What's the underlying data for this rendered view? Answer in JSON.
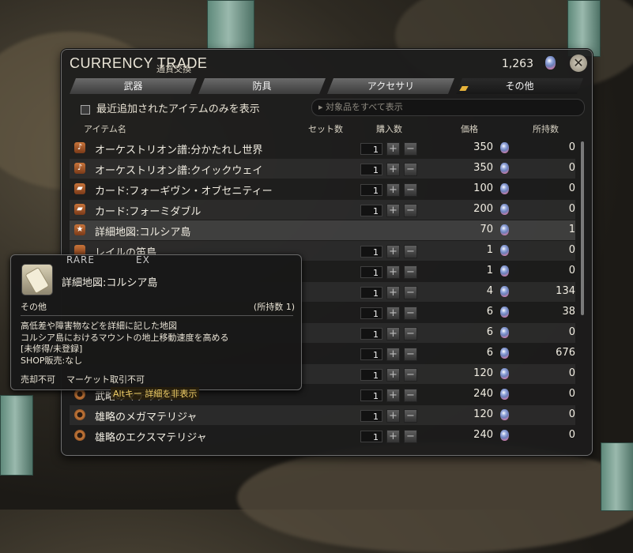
{
  "window": {
    "title": "CURRENCY TRADE",
    "subtitle": "通貨交換",
    "currency_amount": "1,263",
    "close_icon": "close-icon"
  },
  "tabs": [
    {
      "label": "武器",
      "active": false
    },
    {
      "label": "防具",
      "active": false
    },
    {
      "label": "アクセサリ",
      "active": false
    },
    {
      "label": "その他",
      "active": true
    }
  ],
  "filter": {
    "checkbox_label": "最近追加されたアイテムのみを表示",
    "search_placeholder": "▸ 対象品をすべて表示"
  },
  "columns": {
    "name": "アイテム名",
    "set": "セット数",
    "buy": "購入数",
    "price": "価格",
    "owned": "所持数"
  },
  "rows": [
    {
      "icon": "music-icon",
      "name": "オーケストリオン譜:分かたれし世界",
      "qty": "1",
      "price": "350",
      "owned": "0"
    },
    {
      "icon": "music-icon",
      "name": "オーケストリオン譜:クイックウェイ",
      "qty": "1",
      "price": "350",
      "owned": "0"
    },
    {
      "icon": "card-icon",
      "name": "カード:フォーギヴン・オブセニティー",
      "qty": "1",
      "price": "100",
      "owned": "0"
    },
    {
      "icon": "card-icon",
      "name": "カード:フォーミダブル",
      "qty": "1",
      "price": "200",
      "owned": "0"
    },
    {
      "icon": "star-icon",
      "name": "詳細地図:コルシア島",
      "qty": "",
      "price": "70",
      "owned": "1"
    },
    {
      "icon": "item-icon",
      "name": "レイルの笛鳥",
      "qty": "1",
      "price": "1",
      "owned": "0"
    },
    {
      "icon": "item-icon",
      "name": "",
      "qty": "1",
      "price": "1",
      "owned": "0"
    },
    {
      "icon": "item-icon",
      "name": "",
      "qty": "1",
      "price": "4",
      "owned": "134"
    },
    {
      "icon": "item-icon",
      "name": "",
      "qty": "1",
      "price": "6",
      "owned": "38"
    },
    {
      "icon": "item-icon",
      "name": "",
      "qty": "1",
      "price": "6",
      "owned": "0"
    },
    {
      "icon": "item-icon",
      "name": "",
      "qty": "1",
      "price": "6",
      "owned": "676"
    },
    {
      "icon": "item-icon",
      "name": "",
      "qty": "1",
      "price": "120",
      "owned": "0"
    },
    {
      "icon": "materia-icon",
      "name": "武略のマテリジャ",
      "qty": "1",
      "price": "240",
      "owned": "0"
    },
    {
      "icon": "materia-icon",
      "name": "雄略のメガマテリジャ",
      "qty": "1",
      "price": "120",
      "owned": "0"
    },
    {
      "icon": "materia-icon",
      "name": "雄略のエクスマテリジャ",
      "qty": "1",
      "price": "240",
      "owned": "0"
    }
  ],
  "tooltip": {
    "rare": "RARE",
    "ex": "EX",
    "name": "詳細地図:コルシア島",
    "category": "その他",
    "owned": "(所持数 1)",
    "desc_1": "高低差や障害物などを詳細に記した地図",
    "desc_2": "コルシア島におけるマウントの地上移動速度を高める",
    "desc_3": "[未修得/未登録]",
    "desc_4": "SHOP販売:なし",
    "foot_1": "売却不可",
    "foot_2": "マーケット取引不可"
  },
  "hint": "Altキー 詳細を非表示"
}
